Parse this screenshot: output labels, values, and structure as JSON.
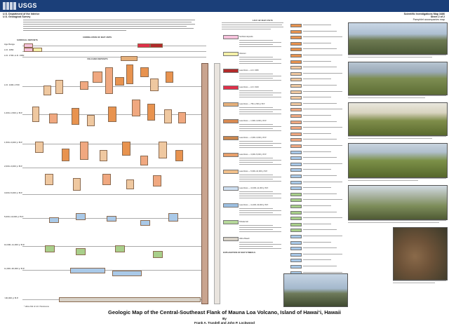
{
  "header": {
    "agency_short": "USGS",
    "department": "U.S. Department of the Interior",
    "survey": "U.S. Geological Survey",
    "series": "Scientific Investigations Map 3486",
    "sheet": "Sheet 2 of 2",
    "pamphlet_note": "Pamphlet accompanies map"
  },
  "correlation": {
    "title": "CORRELATION OF MAP UNITS",
    "surficial": "SURFICIAL DEPOSITS",
    "volcanic": "VOLCANIC DEPOSITS",
    "ages": [
      {
        "label": "Age Range",
        "top": 10
      },
      {
        "label": "A.D. 1950",
        "top": 18
      },
      {
        "label": "A.D. 1700–A.D. 1950",
        "top": 26
      },
      {
        "label": "A.D. 1400–1700",
        "top": 68
      },
      {
        "label": "1,000–1,500 yr B.P.",
        "top": 108
      },
      {
        "label": "1,500–3,000 yr B.P.",
        "top": 150
      },
      {
        "label": "2,000–3,000 yr B.P.",
        "top": 184
      },
      {
        "label": "3,000–5,000 yr B.P.",
        "top": 222
      },
      {
        "label": "5,000–10,000 yr B.P.",
        "top": 256
      },
      {
        "label": "10,000–11,000 yr B.P.",
        "top": 296
      },
      {
        "label": "11,000–30,000 yr B.P.",
        "top": 330
      },
      {
        "label": ">30,000 yr B.P.",
        "top": 372
      }
    ],
    "holocene": "Holocene",
    "pleistocene": "Pleistocene",
    "quaternary": "Quaternary",
    "footnote": "* Hilina Pali of A.D. Pleistocene"
  },
  "units_list": {
    "title": "LIST OF MAP UNITS",
    "items": [
      {
        "color": "#f7c2dc",
        "label": "Surficial deposits"
      },
      {
        "color": "#f4f0a8",
        "label": "Alluvium"
      },
      {
        "color": "#b22a2a",
        "label": "Lava flows — A.D. 1950"
      },
      {
        "color": "#e0304a",
        "label": "Lava flows — A.D. 1919"
      },
      {
        "color": "#e6b07a",
        "label": "Lava flows — 750–1,500 yr B.P."
      },
      {
        "color": "#d98a52",
        "label": "Lava flows — 1,500–3,000 yr B.P."
      },
      {
        "color": "#c9864e",
        "label": "Lava flows — 2,000–3,000 yr B.P."
      },
      {
        "color": "#e8a06b",
        "label": "Lava flows — 3,000–5,000 yr B.P."
      },
      {
        "color": "#f2c08a",
        "label": "Lava flows — 5,000–10,000 yr B.P."
      },
      {
        "color": "#cfe0f2",
        "label": "Lava flows — 10,000–11,000 yr B.P."
      },
      {
        "color": "#9cc0e2",
        "label": "Lava flows — 11,000–30,000 yr B.P."
      },
      {
        "color": "#b6d99a",
        "label": "Pahala Ash"
      },
      {
        "color": "#d8d2c8",
        "label": "Hilina Basalt"
      }
    ],
    "explanation_title": "EXPLANATION OF MAP SYMBOLS"
  },
  "title": "Geologic Map of the Central-Southeast Flank of Mauna Loa Volcano, Island of Hawai‘i, Hawaii",
  "by": "By",
  "authors": "Frank A. Trusdell and John P. Lockwood",
  "chart_colors": {
    "pink": "#f7c2dc",
    "salmon": "#f0a880",
    "orange": "#e8934f",
    "tan": "#efc8a0",
    "blue": "#a9c9e8",
    "green": "#a8cf8a",
    "bar": "#c9a48f"
  }
}
